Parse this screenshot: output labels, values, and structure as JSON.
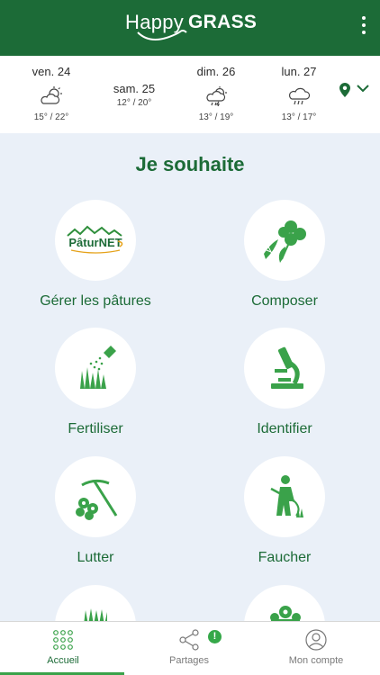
{
  "header": {
    "logo_happy": "Happy",
    "logo_grass": "GRASS",
    "menu_icon": "kebab-menu-icon",
    "bg_color": "#1c6b37"
  },
  "weather": {
    "days": [
      {
        "name": "ven. 24",
        "temp": "15° / 22°",
        "icon": "partly-cloudy-icon"
      },
      {
        "name": "sam. 25",
        "temp": "12° / 20°",
        "icon": ""
      },
      {
        "name": "dim. 26",
        "temp": "13° / 19°",
        "icon": "storm-rain-icon"
      },
      {
        "name": "lun. 27",
        "temp": "13° / 17°",
        "icon": "rain-cloud-icon"
      }
    ],
    "location_icon": "location-pin-icon",
    "chevron_icon": "chevron-down-icon"
  },
  "main": {
    "title": "Je souhaite",
    "tiles": [
      {
        "label": "Gérer les pâtures",
        "logo_text": "PâturNET",
        "icon": "paturnet-logo"
      },
      {
        "label": "Composer",
        "icon": "clover-icon"
      },
      {
        "label": "Fertiliser",
        "icon": "grass-fertilizer-icon"
      },
      {
        "label": "Identifier",
        "icon": "microscope-icon"
      },
      {
        "label": "Lutter",
        "icon": "weed-pickaxe-icon"
      },
      {
        "label": "Faucher",
        "icon": "mower-person-icon"
      },
      {
        "label": "",
        "icon": "grass-icon"
      },
      {
        "label": "",
        "icon": "flowers-icon"
      }
    ]
  },
  "nav": {
    "items": [
      {
        "label": "Accueil",
        "icon": "grid-dots-icon",
        "active": true
      },
      {
        "label": "Partages",
        "icon": "share-icon",
        "active": false
      },
      {
        "label": "Mon compte",
        "icon": "user-icon",
        "active": false
      }
    ],
    "badge": "!"
  },
  "colors": {
    "brand_green": "#1c6b37",
    "accent_green": "#3aa24a",
    "background": "#eaf0f8"
  }
}
